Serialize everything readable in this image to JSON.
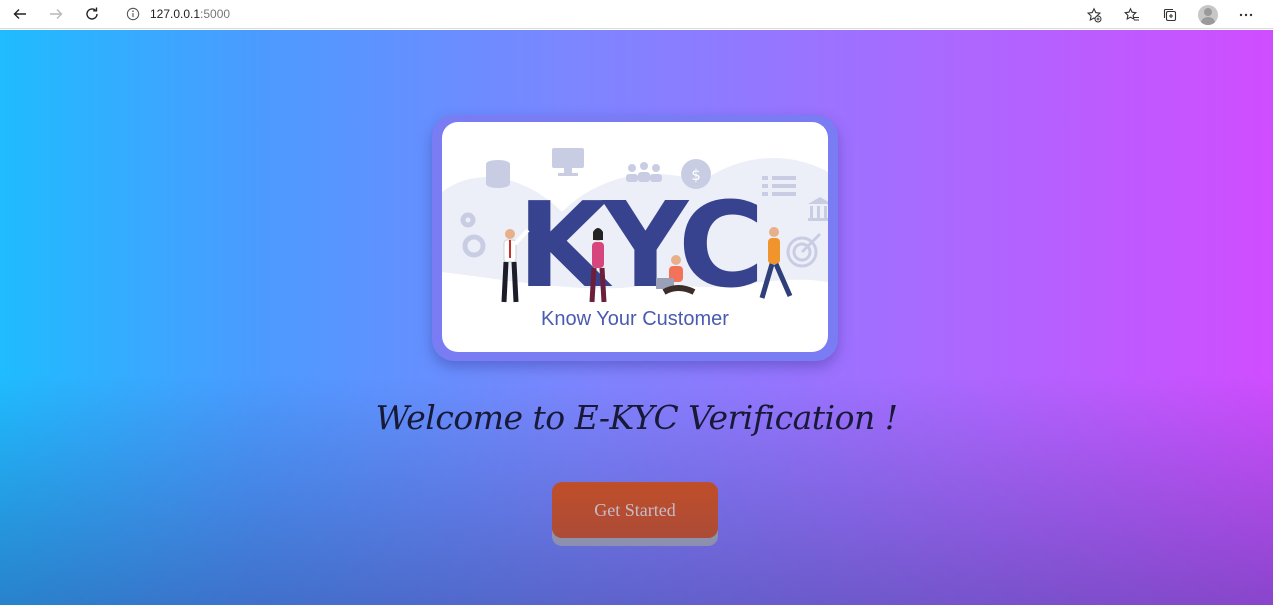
{
  "browser": {
    "address": {
      "host": "127.0.0.1",
      "port": ":5000"
    },
    "icons": {
      "back": "back-arrow-icon",
      "forward": "forward-arrow-icon",
      "reload": "reload-icon",
      "info": "site-info-icon",
      "add_favorite": "add-favorite-icon",
      "favorites": "favorites-icon",
      "collections": "collections-icon",
      "profile": "profile-avatar",
      "menu": "more-menu-icon"
    }
  },
  "hero": {
    "image": {
      "headline": "KYC",
      "caption": "Know Your Customer"
    },
    "welcome": "Welcome to E-KYC Verification !",
    "cta_label": "Get Started"
  },
  "colors": {
    "gradient_left": "#1fbcff",
    "gradient_right": "#d04dff",
    "card_frame": "#7a7cf4",
    "button": "#e5530f",
    "kyc_text": "#38438f"
  }
}
